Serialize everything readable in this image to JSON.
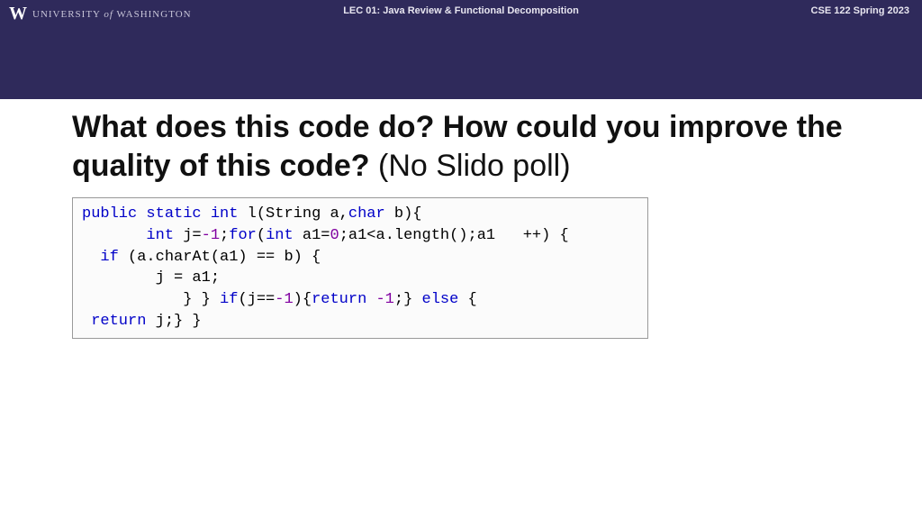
{
  "header": {
    "university_prefix": "UNIVERSITY",
    "university_of": "of",
    "university_name": "WASHINGTON",
    "lecture": "LEC 01: Java Review & Functional Decomposition",
    "course": "CSE 122 Spring 2023"
  },
  "title": {
    "bold": "What does this code do? How could you improve the quality of this code?",
    "regular": " (No Slido poll)"
  },
  "code": {
    "l1_a": "public",
    "l1_b": "static",
    "l1_c": "int",
    "l1_d": " l(String a,",
    "l1_e": "char",
    "l1_f": " b){",
    "l2_a": "       ",
    "l2_b": "int",
    "l2_c": " j=",
    "l2_d": "-1",
    "l2_e": ";",
    "l2_f": "for",
    "l2_g": "(",
    "l2_h": "int",
    "l2_i": " a1=",
    "l2_j": "0",
    "l2_k": ";a1<a.length();a1   ++) {",
    "l3_a": "  ",
    "l3_b": "if",
    "l3_c": " (a.charAt(a1) == b) {",
    "l4_a": "        j = a1;",
    "l5_a": "           } } ",
    "l5_b": "if",
    "l5_c": "(j==",
    "l5_d": "-1",
    "l5_e": "){",
    "l5_f": "return",
    "l5_g": " ",
    "l5_h": "-1",
    "l5_i": ";} ",
    "l5_j": "else",
    "l5_k": " {",
    "l6_a": " ",
    "l6_b": "return",
    "l6_c": " j;} }"
  }
}
